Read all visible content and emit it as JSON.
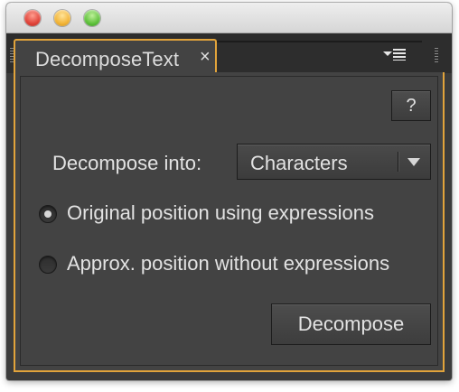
{
  "panel": {
    "tab_title": "DecomposeText",
    "tab_close": "×",
    "help_label": "?",
    "decompose_into_label": "Decompose into:",
    "decompose_into_value": "Characters",
    "options": [
      {
        "label": "Original position using expressions",
        "selected": true
      },
      {
        "label": "Approx. position without expressions",
        "selected": false
      }
    ],
    "decompose_button": "Decompose"
  },
  "colors": {
    "accent_border": "#e1a33b",
    "panel_bg": "#434343",
    "text": "#e2e2e2"
  },
  "icons": [
    "close-window-icon",
    "minimize-window-icon",
    "maximize-window-icon",
    "panel-grip-icon",
    "panel-menu-icon",
    "chevron-down-icon"
  ]
}
